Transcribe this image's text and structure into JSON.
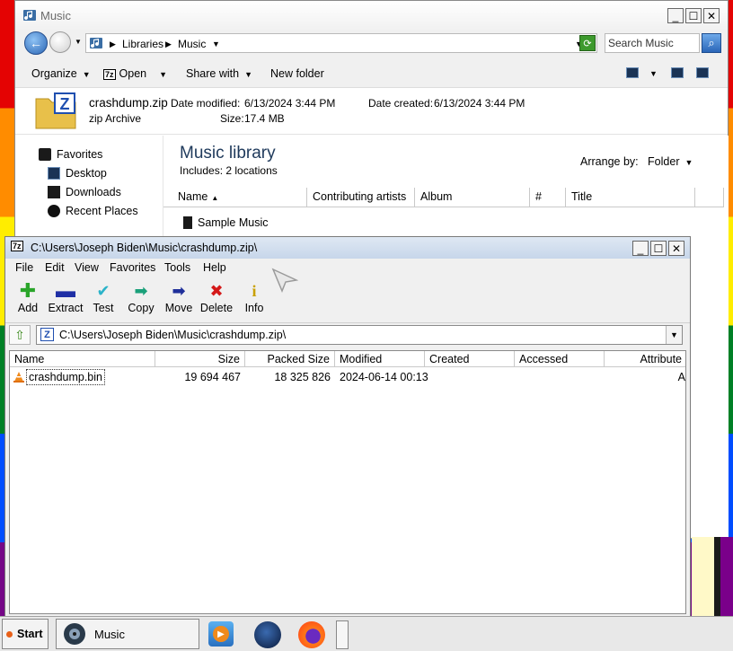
{
  "explorer": {
    "title": "Music",
    "breadcrumb": [
      "Libraries",
      "Music"
    ],
    "search_placeholder": "Search Music",
    "toolbar": {
      "organize": "Organize",
      "open": "Open",
      "share_with": "Share with",
      "new_folder": "New folder"
    },
    "details": {
      "filename": "crashdump.zip",
      "filetype": "zip Archive",
      "modified_label": "Date modified:",
      "modified_value": "6/13/2024 3:44 PM",
      "created_label": "Date created:",
      "created_value": "6/13/2024 3:44 PM",
      "size_label": "Size:",
      "size_value": "17.4 MB"
    },
    "nav": {
      "favorites": "Favorites",
      "desktop": "Desktop",
      "downloads": "Downloads",
      "recent": "Recent Places"
    },
    "library": {
      "title": "Music library",
      "includes_label": "Includes:",
      "includes_value": "2 locations",
      "arrange_label": "Arrange by:",
      "arrange_value": "Folder"
    },
    "columns": [
      "Name",
      "Contributing artists",
      "Album",
      "#",
      "Title"
    ],
    "items": [
      "Sample Music"
    ]
  },
  "zip": {
    "title": "C:\\Users\\Joseph Biden\\Music\\crashdump.zip\\",
    "menu": [
      "File",
      "Edit",
      "View",
      "Favorites",
      "Tools",
      "Help"
    ],
    "toolbar": [
      "Add",
      "Extract",
      "Test",
      "Copy",
      "Move",
      "Delete",
      "Info"
    ],
    "path": "C:\\Users\\Joseph Biden\\Music\\crashdump.zip\\",
    "columns": [
      "Name",
      "Size",
      "Packed Size",
      "Modified",
      "Created",
      "Accessed",
      "Attribute"
    ],
    "rows": [
      {
        "name": "crashdump.bin",
        "size": "19 694 467",
        "packed": "18 325 826",
        "modified": "2024-06-14 00:13",
        "created": "",
        "accessed": "",
        "attr": "A"
      }
    ]
  },
  "taskbar": {
    "start": "Start",
    "task": "Music"
  },
  "colors": {
    "accent": "#2a65b4",
    "zip_title_bar": "#c7d6ea",
    "library_title": "#1e395b"
  }
}
